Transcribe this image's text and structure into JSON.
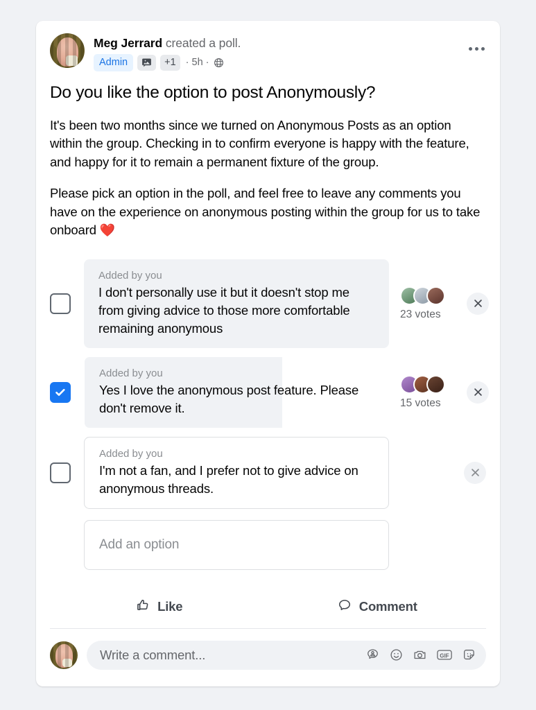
{
  "post": {
    "author": "Meg Jerrard",
    "action_text": " created a poll.",
    "badges": {
      "admin_label": "Admin",
      "photo_icon": "photo-badge-icon",
      "extra_count": "+1"
    },
    "timestamp": "· 5h ·",
    "audience_icon": "group-privacy-icon",
    "more_menu_icon": "more-options-icon",
    "title": "Do you like the option to post Anonymously?",
    "paragraph_1": "It's been two months since we turned on Anonymous Posts as an option within the group. Checking in to confirm everyone is happy with the feature, and happy for it to remain a permanent fixture of the group.",
    "paragraph_2": "Please pick an option in the poll, and feel free to leave any comments you have on the experience on anonymous posting within the group for us to take onboard ",
    "paragraph_2_emoji": "❤️"
  },
  "poll": {
    "added_by_label": "Added by you",
    "options": [
      {
        "text": "I don't personally use it but it doesn't stop me from giving advice to those more comfortable remaining anonymous",
        "checked": false,
        "votes_label": "23 votes",
        "votes": 23,
        "has_votes": true,
        "fill_percent": 100,
        "style": "filled",
        "voter_colors": [
          "#8fae8a",
          "#b9c3cc",
          "#6b4a44"
        ],
        "remove_icon": "remove-option-icon"
      },
      {
        "text": "Yes I love the anonymous post feature. Please don't remove it.",
        "checked": true,
        "votes_label": "15 votes",
        "votes": 15,
        "has_votes": true,
        "fill_percent": 65,
        "style": "partial",
        "voter_colors": [
          "#9a6fb5",
          "#7a4430",
          "#4a2f26"
        ],
        "remove_icon": "remove-option-icon"
      },
      {
        "text": "I'm not a fan, and I prefer not to give advice on anonymous threads.",
        "checked": false,
        "votes_label": "",
        "votes": 0,
        "has_votes": false,
        "fill_percent": 0,
        "style": "outlined",
        "voter_colors": [],
        "remove_icon": "remove-option-icon"
      }
    ],
    "add_option_placeholder": "Add an option"
  },
  "actions": {
    "like_label": "Like",
    "like_icon": "thumbs-up-icon",
    "comment_label": "Comment",
    "comment_icon": "speech-bubble-icon"
  },
  "composer": {
    "placeholder": "Write a comment...",
    "icons": [
      "avatar-bubble-icon",
      "emoji-icon",
      "camera-icon",
      "gif-icon",
      "sticker-icon"
    ],
    "gif_label": "GIF"
  },
  "colors": {
    "page_background": "#f0f2f5",
    "card_background": "#ffffff",
    "accent_blue": "#1877f2",
    "badge_blue_bg": "#e7f3ff",
    "badge_blue_text": "#1b74e4",
    "primary_text": "#050505",
    "secondary_text": "#65676b",
    "muted_text": "#8a8d91"
  }
}
